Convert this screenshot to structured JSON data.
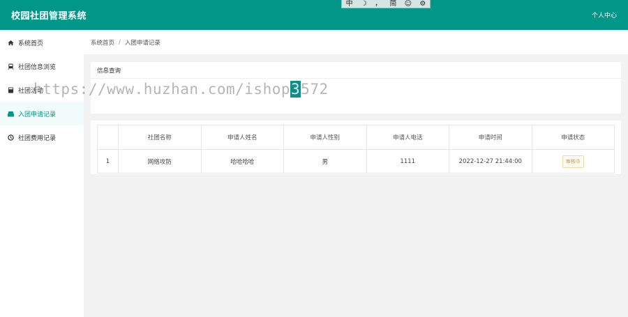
{
  "header": {
    "title": "校园社团管理系统",
    "user_link": "个人中心"
  },
  "ime_bar": {
    "items": [
      "中",
      "☽",
      "，",
      "简",
      "☺",
      "⚙"
    ]
  },
  "sidebar": {
    "items": [
      {
        "label": "系统首页"
      },
      {
        "label": "社团信息浏览"
      },
      {
        "label": "社团活动"
      },
      {
        "label": "入团申请记录"
      },
      {
        "label": "社团费用记录"
      }
    ],
    "active_index": 3
  },
  "breadcrumb": {
    "home": "系统首页",
    "separator": "/",
    "current": "入团申请记录"
  },
  "query": {
    "title": "信息查询"
  },
  "table": {
    "headers": [
      "",
      "社团名称",
      "申请人姓名",
      "申请人性别",
      "申请人电话",
      "申请时间",
      "申请状态"
    ],
    "rows": [
      {
        "index": "1",
        "club": "网络攻防",
        "name": "哈哈哈哈",
        "gender": "男",
        "phone": "1111",
        "time": "2022-12-27 21:44:00",
        "status": "审核中"
      }
    ]
  },
  "watermark": {
    "text_before": "https://www.huzhan.com/ishop",
    "highlight": "3",
    "text_after": "572"
  },
  "colors": {
    "primary": "#009688",
    "status_pending": "#c49a3a"
  }
}
